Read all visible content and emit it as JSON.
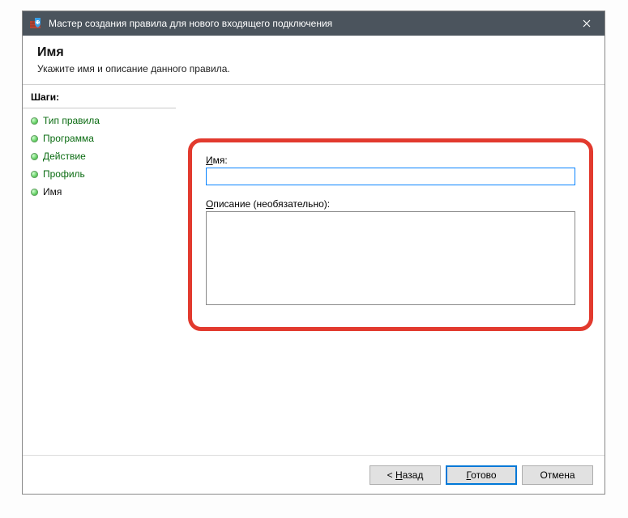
{
  "window": {
    "title": "Мастер создания правила для нового входящего подключения"
  },
  "header": {
    "title": "Имя",
    "subtitle": "Укажите имя и описание данного правила."
  },
  "sidebar": {
    "stepsLabel": "Шаги:",
    "items": [
      {
        "label": "Тип правила",
        "current": false
      },
      {
        "label": "Программа",
        "current": false
      },
      {
        "label": "Действие",
        "current": false
      },
      {
        "label": "Профиль",
        "current": false
      },
      {
        "label": "Имя",
        "current": true
      }
    ]
  },
  "form": {
    "nameLabelPrefix": "И",
    "nameLabelRest": "мя:",
    "nameValue": "",
    "descLabelPrefix": "О",
    "descLabelRest": "писание (необязательно):",
    "descValue": ""
  },
  "buttons": {
    "backPrefix": "< ",
    "backUnderline": "Н",
    "backRest": "азад",
    "finishUnderline": "Г",
    "finishRest": "отово",
    "cancel": "Отмена"
  }
}
